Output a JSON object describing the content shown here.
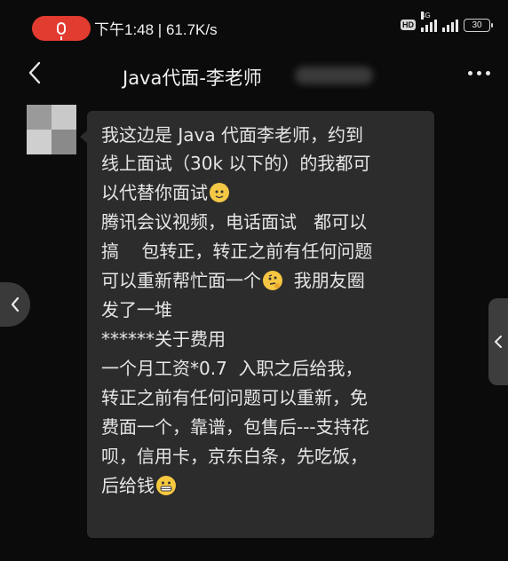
{
  "status_bar": {
    "time_speed": "下午1:48 | 61.7K/s",
    "hd_badge": "HD",
    "network_label": "4G",
    "battery": "30",
    "recording_color": "#e23b2f"
  },
  "header": {
    "title": "Java代面-李老师",
    "back_icon": "chevron-left-icon",
    "more_icon": "more-dots-icon"
  },
  "message": {
    "lines": [
      {
        "text": "我这边是 Java 代面李老师，约到"
      },
      {
        "text": "线上面试（30k 以下的）的我都可"
      },
      {
        "text": "以代替你面试",
        "emoji": "cat-emoji"
      },
      {
        "text": "腾讯会议视频，电话面试   都可以"
      },
      {
        "text": "搞    包转正，转正之前有任何问题"
      },
      {
        "text": "可以重新帮忙面一个",
        "emoji": "thinking-emoji",
        "after": "  我朋友圈"
      },
      {
        "text": "发了一堆"
      },
      {
        "text": "******关于费用"
      },
      {
        "text": "一个月工资*0.7  入职之后给我，"
      },
      {
        "text": "转正之前有任何问题可以重新，免"
      },
      {
        "text": "费面一个，靠谱，包售后---支持花"
      },
      {
        "text": "呗，信用卡，京东白条，先吃饭，"
      },
      {
        "text": "后给钱",
        "emoji": "grinning-emoji"
      }
    ],
    "bubble_color": "#2c2c2c"
  }
}
